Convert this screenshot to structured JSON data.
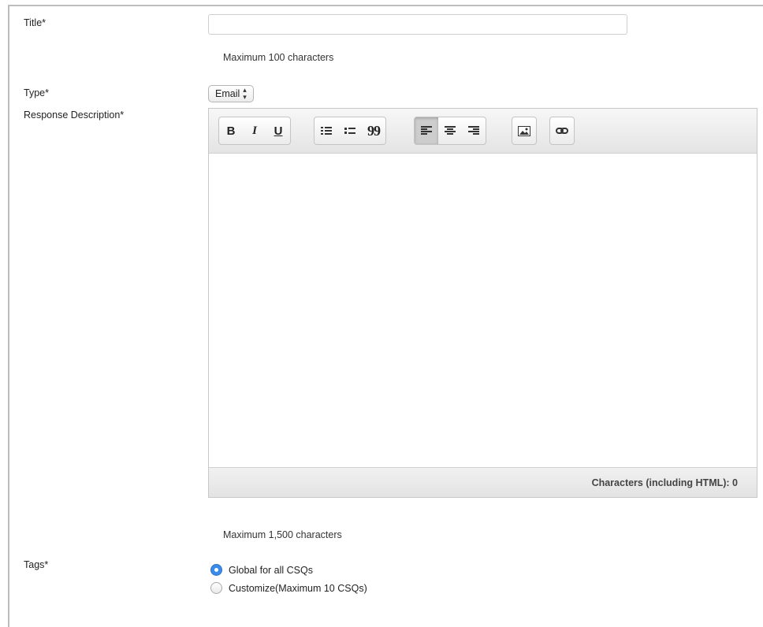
{
  "form": {
    "title_label": "Title*",
    "title_value": "",
    "title_hint": "Maximum 100 characters",
    "type_label": "Type*",
    "type_selected": "Email",
    "response_label": "Response Description*",
    "response_hint": "Maximum 1,500 characters",
    "tags_label": "Tags*"
  },
  "editor": {
    "toolbar": {
      "bold": "B",
      "italic": "I",
      "underline": "U",
      "quote": "99"
    },
    "status": "Characters (including HTML): 0",
    "icons": [
      "bold-icon",
      "italic-icon",
      "underline-icon",
      "ordered-list-icon",
      "bullet-list-icon",
      "blockquote-icon",
      "align-left-icon",
      "align-center-icon",
      "align-right-icon",
      "image-icon",
      "link-icon"
    ]
  },
  "tags": {
    "options": [
      {
        "label": "Global for all CSQs",
        "checked": true
      },
      {
        "label": "Customize(Maximum 10 CSQs)",
        "checked": false
      }
    ]
  },
  "colors": {
    "radio_checked": "#3b8beb",
    "active_button": "#cdcdcd"
  }
}
